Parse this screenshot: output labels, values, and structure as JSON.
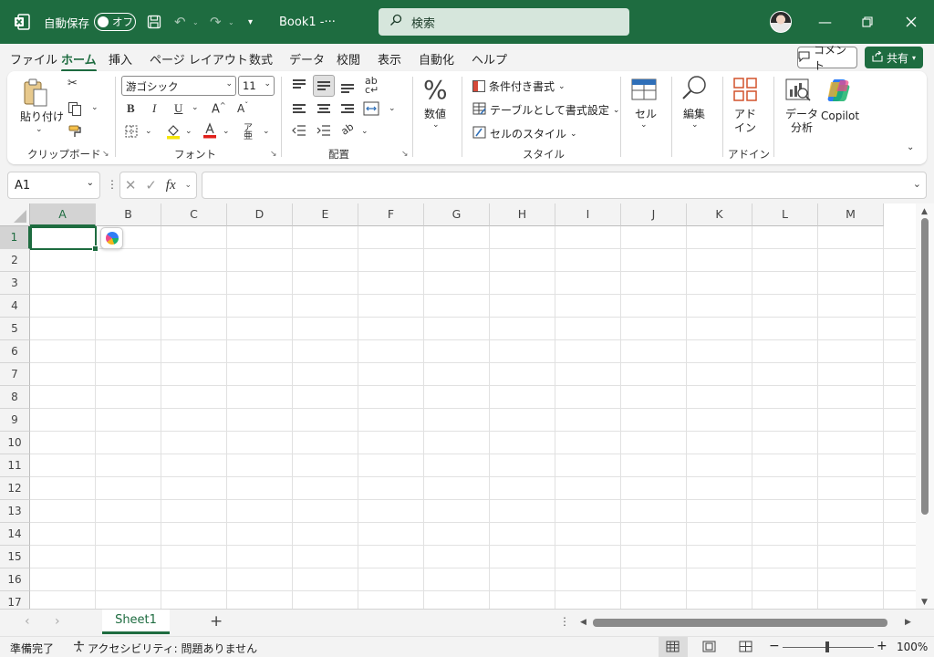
{
  "titlebar": {
    "autosave_label": "自動保存",
    "autosave_state": "オフ",
    "book_title": "Book1  -···",
    "search_placeholder": "検索"
  },
  "tabs": [
    "ファイル",
    "ホーム",
    "挿入",
    "ページ レイアウト",
    "数式",
    "データ",
    "校閲",
    "表示",
    "自動化",
    "ヘルプ"
  ],
  "active_tab": "ホーム",
  "actions": {
    "comment": "コメント",
    "share": "共有"
  },
  "ribbon": {
    "clipboard": {
      "paste": "貼り付け",
      "label": "クリップボード"
    },
    "font": {
      "name": "游ゴシック",
      "size": "11",
      "label": "フォント",
      "bold": "B",
      "italic": "I",
      "underline": "U"
    },
    "alignment": {
      "label": "配置"
    },
    "number": {
      "label": "数値",
      "icon": "%"
    },
    "styles": {
      "conditional": "条件付き書式",
      "table": "テーブルとして書式設定",
      "cell_styles": "セルのスタイル",
      "label": "スタイル"
    },
    "cells": {
      "label": "セル"
    },
    "editing": {
      "label": "編集"
    },
    "addins": {
      "button": "アド\nイン",
      "label": "アドイン"
    },
    "analysis": {
      "button": "データ\n分析"
    },
    "copilot": {
      "button": "Copilot"
    }
  },
  "formula_bar": {
    "name_box": "A1",
    "fx": "fx",
    "formula": ""
  },
  "grid": {
    "columns": [
      "A",
      "B",
      "C",
      "D",
      "E",
      "F",
      "G",
      "H",
      "I",
      "J",
      "K",
      "L",
      "M"
    ],
    "rows": [
      "1",
      "2",
      "3",
      "4",
      "5",
      "6",
      "7",
      "8",
      "9",
      "10",
      "11",
      "12",
      "13",
      "14",
      "15",
      "16",
      "17"
    ],
    "active_cell": "A1"
  },
  "sheets": {
    "tabs": [
      "Sheet1"
    ],
    "active": "Sheet1",
    "add": "+"
  },
  "status": {
    "ready": "準備完了",
    "accessibility": "アクセシビリティ: 問題ありません",
    "zoom": "100%"
  },
  "colors": {
    "accent": "#1e6c40",
    "ribbon_bg": "#ffffff",
    "chrome_bg": "#f3f3f3"
  }
}
